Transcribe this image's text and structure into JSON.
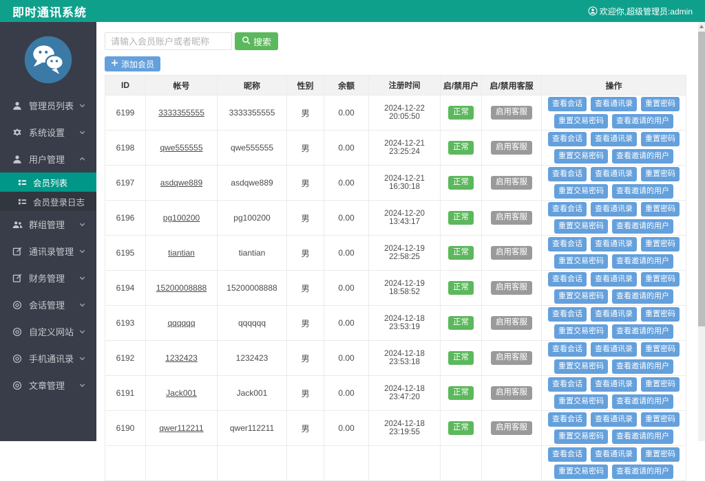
{
  "header": {
    "title": "即时通讯系统",
    "welcome": "欢迎你,超级管理员:admin",
    "welcome_icon": "user-circle-icon"
  },
  "sidebar": {
    "logo_icon": "wechat-logo-icon",
    "items": [
      {
        "label": "管理员列表",
        "icon": "user-icon",
        "chevron": "down"
      },
      {
        "label": "系统设置",
        "icon": "gear-icon",
        "chevron": "down"
      },
      {
        "label": "用户管理",
        "icon": "user-icon",
        "chevron": "up",
        "children": [
          {
            "label": "会员列表",
            "icon": "list-icon",
            "active": true
          },
          {
            "label": "会员登录日志",
            "icon": "list-icon",
            "active": false
          }
        ]
      },
      {
        "label": "群组管理",
        "icon": "users-icon",
        "chevron": "down"
      },
      {
        "label": "通讯录管理",
        "icon": "edit-icon",
        "chevron": "down"
      },
      {
        "label": "财务管理",
        "icon": "edit-icon",
        "chevron": "down"
      },
      {
        "label": "会话管理",
        "icon": "circle-dot-icon",
        "chevron": "down"
      },
      {
        "label": "自定义网站",
        "icon": "circle-dot-icon",
        "chevron": "down"
      },
      {
        "label": "手机通讯录",
        "icon": "circle-dot-icon",
        "chevron": "down"
      },
      {
        "label": "文章管理",
        "icon": "circle-dot-icon",
        "chevron": "down"
      }
    ]
  },
  "toolbar": {
    "search_placeholder": "请输入会员账户或者昵称",
    "search_label": "搜索",
    "search_icon": "search-icon",
    "add_member_label": "添加会员",
    "add_icon": "plus-icon"
  },
  "table": {
    "headers": [
      "ID",
      "帐号",
      "昵称",
      "性别",
      "余额",
      "注册时间",
      "启/禁用户",
      "启/禁用客服",
      "操作"
    ],
    "rows": [
      {
        "id": "6199",
        "account": "3333355555",
        "nickname": "3333355555",
        "gender": "男",
        "balance": "0.00",
        "registered": "2024-12-22 20:05:50",
        "user_status": "正常",
        "service_status": "启用客服",
        "actions": [
          "查看会话",
          "查看通讯录",
          "重置密码",
          "重置交易密码",
          "查看邀请的用户"
        ]
      },
      {
        "id": "6198",
        "account": "qwe555555",
        "nickname": "qwe555555",
        "gender": "男",
        "balance": "0.00",
        "registered": "2024-12-21 23:25:24",
        "user_status": "正常",
        "service_status": "启用客服",
        "actions": [
          "查看会话",
          "查看通讯录",
          "重置密码",
          "重置交易密码",
          "查看邀请的用户"
        ]
      },
      {
        "id": "6197",
        "account": "asdqwe889",
        "nickname": "asdqwe889",
        "gender": "男",
        "balance": "0.00",
        "registered": "2024-12-21 16:30:18",
        "user_status": "正常",
        "service_status": "启用客服",
        "actions": [
          "查看会话",
          "查看通讯录",
          "重置密码",
          "重置交易密码",
          "查看邀请的用户"
        ]
      },
      {
        "id": "6196",
        "account": "pg100200",
        "nickname": "pg100200",
        "gender": "男",
        "balance": "0.00",
        "registered": "2024-12-20 13:43:17",
        "user_status": "正常",
        "service_status": "启用客服",
        "actions": [
          "查看会话",
          "查看通讯录",
          "重置密码",
          "重置交易密码",
          "查看邀请的用户"
        ]
      },
      {
        "id": "6195",
        "account": "tiantian",
        "nickname": "tiantian",
        "gender": "男",
        "balance": "0.00",
        "registered": "2024-12-19 22:58:25",
        "user_status": "正常",
        "service_status": "启用客服",
        "actions": [
          "查看会话",
          "查看通讯录",
          "重置密码",
          "重置交易密码",
          "查看邀请的用户"
        ]
      },
      {
        "id": "6194",
        "account": "15200008888",
        "nickname": "15200008888",
        "gender": "男",
        "balance": "0.00",
        "registered": "2024-12-19 18:58:52",
        "user_status": "正常",
        "service_status": "启用客服",
        "actions": [
          "查看会话",
          "查看通讯录",
          "重置密码",
          "重置交易密码",
          "查看邀请的用户"
        ]
      },
      {
        "id": "6193",
        "account": "qqqqqq",
        "nickname": "qqqqqq",
        "gender": "男",
        "balance": "0.00",
        "registered": "2024-12-18 23:53:19",
        "user_status": "正常",
        "service_status": "启用客服",
        "actions": [
          "查看会话",
          "查看通讯录",
          "重置密码",
          "重置交易密码",
          "查看邀请的用户"
        ]
      },
      {
        "id": "6192",
        "account": "1232423",
        "nickname": "1232423",
        "gender": "男",
        "balance": "0.00",
        "registered": "2024-12-18 23:53:18",
        "user_status": "正常",
        "service_status": "启用客服",
        "actions": [
          "查看会话",
          "查看通讯录",
          "重置密码",
          "重置交易密码",
          "查看邀请的用户"
        ]
      },
      {
        "id": "6191",
        "account": "Jack001",
        "nickname": "Jack001",
        "gender": "男",
        "balance": "0.00",
        "registered": "2024-12-18 23:47:20",
        "user_status": "正常",
        "service_status": "启用客服",
        "actions": [
          "查看会话",
          "查看通讯录",
          "重置密码",
          "重置交易密码",
          "查看邀请的用户"
        ]
      },
      {
        "id": "6190",
        "account": "qwer112211",
        "nickname": "qwer112211",
        "gender": "男",
        "balance": "0.00",
        "registered": "2024-12-18 23:19:55",
        "user_status": "正常",
        "service_status": "启用客服",
        "actions": [
          "查看会话",
          "查看通讯录",
          "重置密码",
          "重置交易密码",
          "查看邀请的用户"
        ]
      },
      {
        "id": "",
        "account": "",
        "nickname": "",
        "gender": "",
        "balance": "",
        "registered": "",
        "user_status": "",
        "service_status": "",
        "actions": [
          "查看会话",
          "查看通讯录",
          "重置密码",
          "重置交易密码",
          "查看邀请的用户"
        ]
      }
    ]
  },
  "colors": {
    "header_bg": "#0FA08C",
    "sidebar_bg": "#393D49",
    "submenu_bg": "#32363F",
    "active_item_bg": "#009688",
    "logo_blue": "#3B7AA6",
    "search_button_green": "#5CB85C",
    "action_button_blue": "#64A0DC",
    "status_ok_green": "#5CB85C",
    "service_badge_gray": "#9A9A9A",
    "table_header_bg": "#F2F2F2"
  }
}
